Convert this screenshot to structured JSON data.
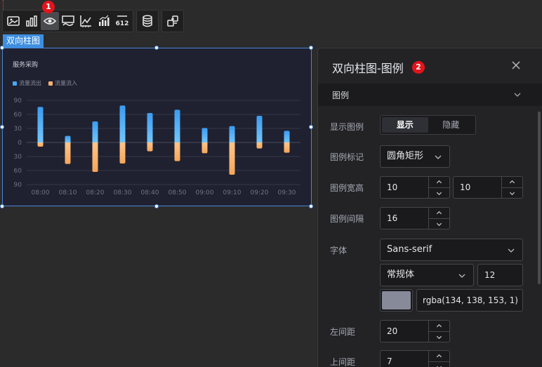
{
  "toolbar": {
    "group1": [
      {
        "icon": "image-icon"
      },
      {
        "icon": "bar-chart-icon"
      },
      {
        "icon": "visibility-icon",
        "active": true
      },
      {
        "icon": "line-chart-icon"
      },
      {
        "icon": "axis-icon"
      },
      {
        "icon": "data-label-icon"
      },
      {
        "icon": "number-icon",
        "text": "612"
      }
    ],
    "group2": [
      {
        "icon": "database-icon"
      }
    ],
    "group3": [
      {
        "icon": "link-icon"
      }
    ],
    "badge": "1"
  },
  "component_tag": "双向柱图",
  "chart_data": {
    "type": "bar",
    "title": "服务采购",
    "legend": [
      "流量流出",
      "流量流入"
    ],
    "categories": [
      "08:00",
      "08:10",
      "08:20",
      "08:30",
      "08:40",
      "08:50",
      "09:00",
      "09:10",
      "09:20",
      "09:30"
    ],
    "series": [
      {
        "name": "流量流出",
        "values": [
          76,
          14,
          45,
          79,
          63,
          70,
          31,
          35,
          57,
          25
        ],
        "color_top": "#3a9bf0",
        "color_bottom": "#74c6fb"
      },
      {
        "name": "流量流入",
        "values": [
          -9,
          -46,
          -63,
          -45,
          -19,
          -40,
          -23,
          -69,
          -13,
          -22
        ],
        "color_top": "#ffc58a",
        "color_bottom": "#f5a55a"
      }
    ],
    "y_tick_labels": [
      "90",
      "60",
      "30",
      "0",
      "30",
      "60",
      "90"
    ],
    "ylim": [
      -90,
      90
    ],
    "grid": true
  },
  "panel": {
    "title": "双向柱图-图例",
    "badge": "2",
    "section": "图例",
    "show_legend_label": "显示图例",
    "show_option": "显示",
    "hide_option": "隐藏",
    "marker_label": "图例标记",
    "marker_value": "圆角矩形",
    "size_label": "图例宽高",
    "width_value": "10",
    "height_value": "10",
    "gap_label": "图例间隔",
    "gap_value": "16",
    "font_label": "字体",
    "font_family": "Sans-serif",
    "font_weight": "常规体",
    "font_size": "12",
    "font_color": "rgba(134, 138, 153, 1)",
    "font_color_hex": "#868a99",
    "left_label": "左间距",
    "left_value": "20",
    "top_label": "上间距",
    "top_value": "7"
  }
}
